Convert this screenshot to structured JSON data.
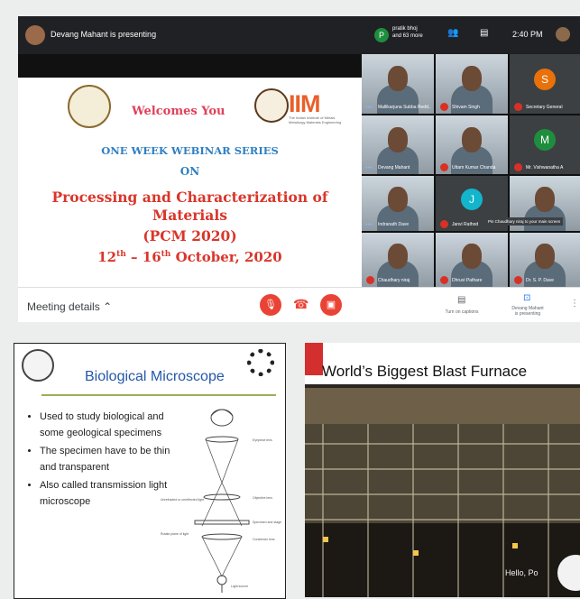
{
  "topbar": {
    "presenter_text": "Devang Mahant is presenting",
    "participants_initial": "P",
    "participants_line1": "pratik bhoj",
    "participants_line2": "and 63 more",
    "time": "2:40 PM"
  },
  "slide": {
    "welcome": "Welcomes You",
    "org_logo_text": "IIM",
    "org_logo_sub": "The Indian Institute of Metals Metallurgy Materials Engineering",
    "series": "ONE WEEK WEBINAR SERIES",
    "on": "ON",
    "title_line1": "Processing and Characterization of",
    "title_line2": "Materials",
    "acronym": "(PCM 2020)",
    "date_start": "12",
    "date_start_sup": "th",
    "date_sep": " – ",
    "date_end": "16",
    "date_end_sup": "th",
    "date_rest": " October, 2020"
  },
  "tiles": [
    {
      "name": "Mallikarjuna Subba Redd..",
      "type": "video",
      "indicator": "dots"
    },
    {
      "name": "Shivam Singh",
      "type": "video",
      "indicator": "mic"
    },
    {
      "name": "Secretary General",
      "type": "avatar",
      "initial": "S",
      "color": "#e8710a",
      "indicator": "mic"
    },
    {
      "name": "Devang Mahant",
      "type": "video",
      "indicator": "dots"
    },
    {
      "name": "Uttam Kumar Chanda",
      "type": "video",
      "indicator": "mic"
    },
    {
      "name": "Mr. Vishwanatha A",
      "type": "avatar",
      "initial": "M",
      "color": "#1e8e3e",
      "indicator": "mic"
    },
    {
      "name": "Indranath Dave",
      "type": "video",
      "indicator": "dots"
    },
    {
      "name": "Janvi Rathod",
      "type": "avatar",
      "initial": "J",
      "color": "#12b5cb",
      "indicator": "mic"
    },
    {
      "name": "",
      "type": "video",
      "indicator": "none"
    },
    {
      "name": "Chaudhary niraj",
      "type": "video",
      "indicator": "mic"
    },
    {
      "name": "Dhruvi Pathare",
      "type": "video",
      "indicator": "mic"
    },
    {
      "name": "Dr. S. P. Dave",
      "type": "video",
      "indicator": "mic"
    }
  ],
  "tooltip": "Pin Chaudhary niraj to your main screen",
  "bottombar": {
    "meeting_details": "Meeting details",
    "captions_label": "Turn on captions",
    "presenting_label_1": "Devang Mahant",
    "presenting_label_2": "is presenting"
  },
  "microscope": {
    "title": "Biological Microscope",
    "bullets": [
      "Used to study biological and some geological specimens",
      "The specimen have to be thin and transparent",
      "Also called transmission light microscope"
    ],
    "diagram_labels": [
      "Eyepiece lens",
      "Objective lens",
      "Unrefracted or unreflected light",
      "Specimen and stage",
      "Rotate plane of light",
      "Condenser lens",
      "Light source"
    ]
  },
  "furnace": {
    "title": "World’s Biggest Blast Furnace",
    "overlay": "Hello, Po"
  },
  "colors": {
    "meet_dark": "#202124",
    "end_call_red": "#ea4335",
    "slide_red": "#d9362b",
    "slide_blue": "#2f7fc2",
    "microscope_title": "#2458a8"
  }
}
